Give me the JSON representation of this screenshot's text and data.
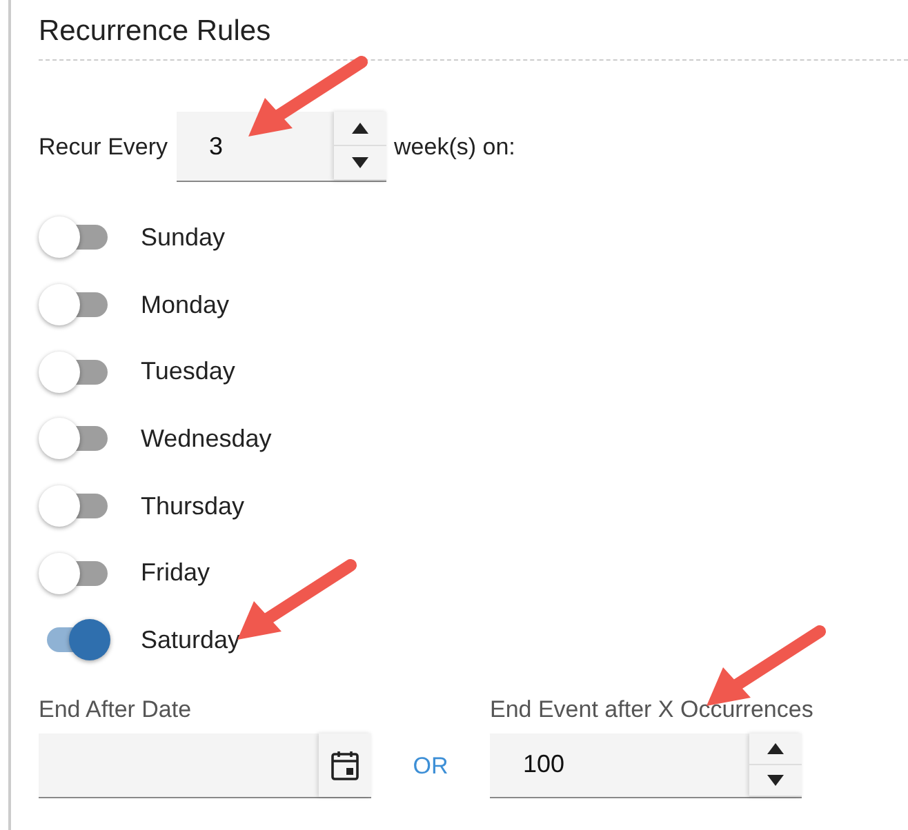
{
  "title": "Recurrence Rules",
  "recur": {
    "label": "Recur Every",
    "value": "3",
    "unit": "week(s) on:"
  },
  "days": [
    {
      "label": "Sunday",
      "on": false
    },
    {
      "label": "Monday",
      "on": false
    },
    {
      "label": "Tuesday",
      "on": false
    },
    {
      "label": "Wednesday",
      "on": false
    },
    {
      "label": "Thursday",
      "on": false
    },
    {
      "label": "Friday",
      "on": false
    },
    {
      "label": "Saturday",
      "on": true
    }
  ],
  "end_date": {
    "label": "End After Date"
  },
  "separator": "OR",
  "occurrences": {
    "label": "End Event after X Occurrences",
    "value": "100"
  }
}
